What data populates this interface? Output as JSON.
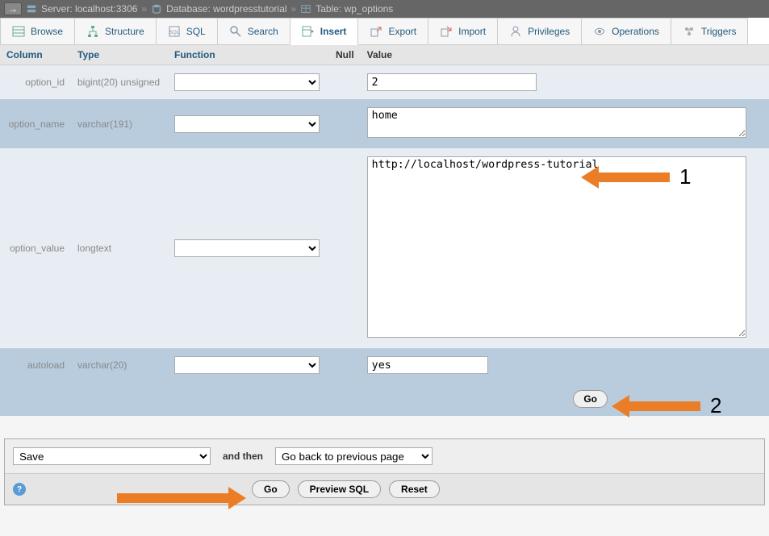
{
  "breadcrumb": {
    "server_label": "Server:",
    "server_value": "localhost:3306",
    "database_label": "Database:",
    "database_value": "wordpresstutorial",
    "table_label": "Table:",
    "table_value": "wp_options"
  },
  "tabs": [
    {
      "label": "Browse",
      "icon": "browse"
    },
    {
      "label": "Structure",
      "icon": "structure"
    },
    {
      "label": "SQL",
      "icon": "sql"
    },
    {
      "label": "Search",
      "icon": "search"
    },
    {
      "label": "Insert",
      "icon": "insert",
      "active": true
    },
    {
      "label": "Export",
      "icon": "export"
    },
    {
      "label": "Import",
      "icon": "import"
    },
    {
      "label": "Privileges",
      "icon": "privileges"
    },
    {
      "label": "Operations",
      "icon": "operations"
    },
    {
      "label": "Triggers",
      "icon": "triggers"
    }
  ],
  "headers": {
    "column": "Column",
    "type": "Type",
    "function": "Function",
    "null": "Null",
    "value": "Value"
  },
  "rows": [
    {
      "column": "option_id",
      "type": "bigint(20) unsigned",
      "value": "2",
      "input": "text"
    },
    {
      "column": "option_name",
      "type": "varchar(191)",
      "value": "home",
      "input": "textarea_small"
    },
    {
      "column": "option_value",
      "type": "longtext",
      "value": "http://localhost/wordpress-tutorial",
      "input": "textarea_large"
    },
    {
      "column": "autoload",
      "type": "varchar(20)",
      "value": "yes",
      "input": "text"
    }
  ],
  "go_button": "Go",
  "bottom": {
    "action_select": "Save",
    "and_then": "and then",
    "then_select": "Go back to previous page",
    "go": "Go",
    "preview": "Preview SQL",
    "reset": "Reset"
  },
  "annotations": {
    "one": "1",
    "two": "2"
  }
}
